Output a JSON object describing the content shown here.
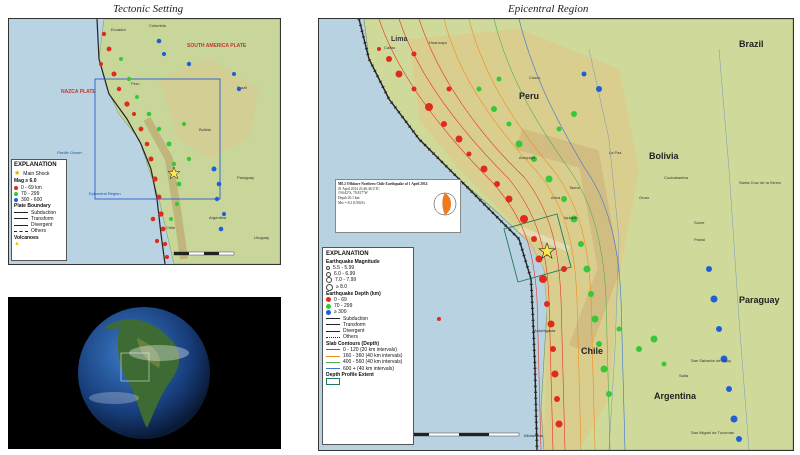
{
  "titles": {
    "left": "Tectonic Setting",
    "right": "Epicentral Region"
  },
  "left_map": {
    "plates": [
      "NAZCA PLATE",
      "SOUTH AMERICA PLATE"
    ],
    "places": [
      "Ecuador",
      "Peru",
      "Bolivia",
      "Chile",
      "Brazil",
      "Paraguay",
      "Argentina",
      "Uruguay",
      "Colombia"
    ],
    "ocean_label": "Pacific Ocean",
    "region_label": "Epicentral Region",
    "legend": {
      "title": "EXPLANATION",
      "main_shock": "Main Shock",
      "mag_title": "Mag ≥ 6.0",
      "depths": [
        {
          "label": "0 - 69 km",
          "color": "#e02a1a"
        },
        {
          "label": "70 - 299",
          "color": "#36c83a"
        },
        {
          "label": "300 - 600",
          "color": "#1e5fd8"
        }
      ],
      "plate_boundary_title": "Plate Boundary",
      "boundaries": [
        "Subduction",
        "Transform",
        "Divergent",
        "Others"
      ],
      "volcanoes_label": "Volcanoes"
    }
  },
  "right_map": {
    "countries": [
      "Peru",
      "Bolivia",
      "Chile",
      "Brazil",
      "Paraguay",
      "Argentina"
    ],
    "cities": [
      "Lima",
      "Callao",
      "Huancayo",
      "Arequipa",
      "La Paz",
      "Cochabamba",
      "Santa Cruz de la Sierra",
      "Sucre",
      "Potosi",
      "Iquique",
      "Antofagasta",
      "Salta",
      "San Salvador de Jujuy",
      "San Miguel de Tucuman",
      "Oruro",
      "Tacna",
      "Arica",
      "Cusco"
    ],
    "info": {
      "title": "M8.2 Offshore Northern Chile Earthquake of 1 April 2014",
      "line1": "01 April 2014 23:46:46 UTC",
      "line2": "19.642°S, 70.817°W",
      "line3": "Depth 20.1 km",
      "line4": "Mw = 8.2 (USGS)"
    },
    "legend": {
      "title": "EXPLANATION",
      "mag_title": "Earthquake Magnitude",
      "mags": [
        "5.5 - 5.99",
        "6.0 - 6.99",
        "7.0 - 7.99",
        "≥ 8.0"
      ],
      "depth_title": "Earthquake Depth (km)",
      "depths": [
        {
          "label": "0 - 69",
          "color": "#e02a1a"
        },
        {
          "label": "70 - 299",
          "color": "#36c83a"
        },
        {
          "label": "≥ 300",
          "color": "#1e5fd8"
        }
      ],
      "boundaries": [
        "Subduction",
        "Transform",
        "Divergent",
        "Others"
      ],
      "slab_title": "Slab Contours (Depth)",
      "slab": [
        {
          "label": "0 - 120 (20 km intervals)",
          "color": "#e0341e"
        },
        {
          "label": "160 - 360 (40 km intervals)",
          "color": "#f08c1e"
        },
        {
          "label": "400 - 560 (40 km intervals)",
          "color": "#4fb04f"
        },
        {
          "label": "600 + (40 km intervals)",
          "color": "#3a72d6"
        }
      ],
      "profile_label": "Depth Profile Extent"
    },
    "scale_label": "Kilometers"
  },
  "colors": {
    "ocean": "#b9d3e3",
    "land": "#c9d69a",
    "shallow": "#e02a1a",
    "intermediate": "#36c83a",
    "deep": "#1e5fd8"
  }
}
